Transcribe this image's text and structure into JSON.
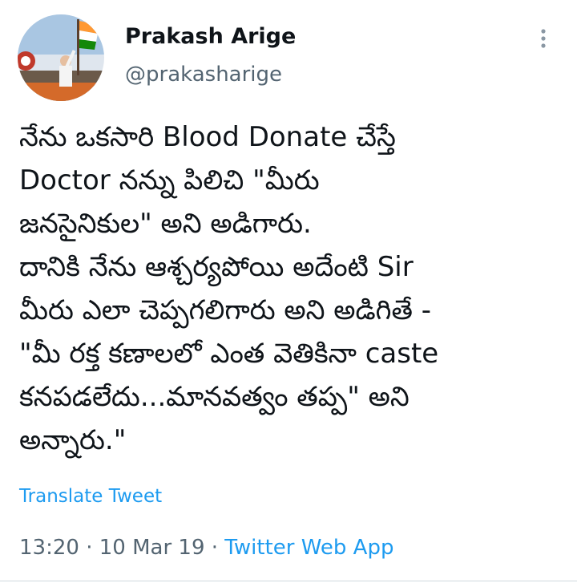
{
  "author": {
    "name": "Prakash Arige",
    "handle": "@prakasharige"
  },
  "tweet": {
    "lines": [
      "నేను ఒకసారి Blood Donate చేస్తే",
      "Doctor నన్ను పిలిచి \"మీరు",
      "జనసైనికుల\" అని అడిగారు.",
      "దానికి నేను ఆశ్చర్యపోయి అదేంటి Sir",
      "మీరు ఎలా చెప్పగలిగారు అని అడిగితే -",
      "\"మీ రక్త కణాలలో ఎంత వెతికినా caste",
      "కనపడలేదు...మానవత్వం తప్ప\" అని",
      "అన్నారు.\""
    ],
    "translate_label": "Translate Tweet"
  },
  "meta": {
    "time": "13:20",
    "separator1": " · ",
    "date": "10 Mar 19",
    "separator2": " · ",
    "source": "Twitter Web App"
  },
  "icons": {
    "more": "more-vertical-icon",
    "avatar": "profile-avatar"
  },
  "colors": {
    "link": "#1d9bf0",
    "secondary_text": "#536471",
    "primary_text": "#0f1419"
  }
}
